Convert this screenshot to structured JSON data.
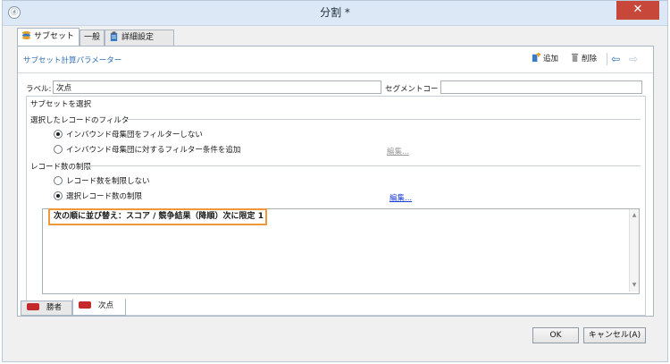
{
  "window": {
    "title": "分割 *",
    "close_glyph": "✕",
    "app_icon": "circle-gear-icon"
  },
  "tabs": [
    {
      "label": "サブセット",
      "icon": "stack-icon",
      "active": true
    },
    {
      "label": "一般",
      "icon": "",
      "active": false
    },
    {
      "label": "詳細設定",
      "icon": "clipboard-icon",
      "active": false
    }
  ],
  "panel": {
    "title": "サブセット計算パラメーター",
    "toolbar": {
      "add_label": "追加",
      "delete_label": "削除",
      "back_glyph": "⇦",
      "forward_glyph": "⇨"
    }
  },
  "form": {
    "label_caption": "ラベル:",
    "label_value": "次点",
    "segment_caption": "セグメントコード:",
    "segment_value": ""
  },
  "subset": {
    "heading": "サブセットを選択",
    "filter_group": {
      "title": "選択したレコードのフィルター",
      "options": [
        {
          "label": "インバウンド母集団をフィルターしない",
          "selected": true
        },
        {
          "label": "インバウンド母集団に対するフィルター条件を追加",
          "selected": false
        }
      ],
      "edit_link": "編集..."
    },
    "limit_group": {
      "title": "レコード数の制限",
      "options": [
        {
          "label": "レコード数を制限しない",
          "selected": false
        },
        {
          "label": "選択レコード数の制限",
          "selected": true
        }
      ],
      "edit_link": "編集..."
    },
    "summary_text": "次の順に並び替え：スコア / 競争結果（降順）次に限定 1"
  },
  "bottom_tabs": [
    {
      "label": "勝者",
      "icon": "segment-icon",
      "active": false
    },
    {
      "label": "次点",
      "icon": "segment-icon",
      "active": true
    }
  ],
  "buttons": {
    "ok": "OK",
    "cancel": "キャンセル(A)"
  },
  "colors": {
    "highlight_border": "#ef9a3a",
    "link": "#1a3fd6",
    "panel_title": "#2f6eb8",
    "close_button": "#c7473b",
    "segment_icon": "#c52a2a"
  }
}
